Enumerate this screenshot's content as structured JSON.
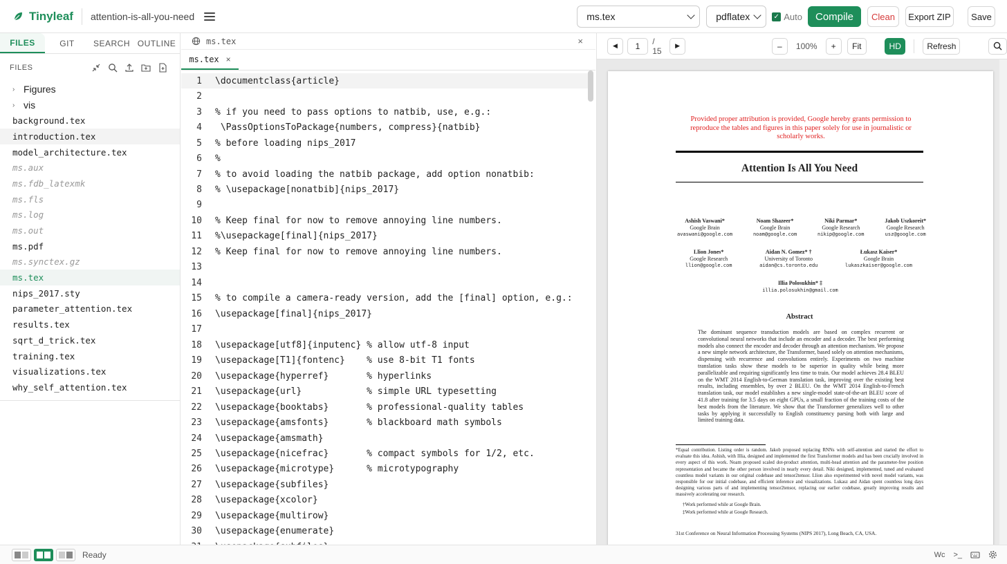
{
  "app": {
    "name": "Tinyleaf",
    "project": "attention-is-all-you-need"
  },
  "toolbar": {
    "main_file": "ms.tex",
    "engine": "pdflatex",
    "auto_label": "Auto",
    "compile_label": "Compile",
    "clean_label": "Clean",
    "export_label": "Export ZIP",
    "save_label": "Save"
  },
  "sidebar": {
    "tabs": [
      "FILES",
      "GIT",
      "SEARCH",
      "OUTLINE"
    ],
    "files_heading": "FILES",
    "items": [
      {
        "name": "Figures",
        "type": "folder"
      },
      {
        "name": "vis",
        "type": "folder"
      },
      {
        "name": "background.tex",
        "type": "file"
      },
      {
        "name": "introduction.tex",
        "type": "file"
      },
      {
        "name": "model_architecture.tex",
        "type": "file"
      },
      {
        "name": "ms.aux",
        "type": "generated"
      },
      {
        "name": "ms.fdb_latexmk",
        "type": "generated"
      },
      {
        "name": "ms.fls",
        "type": "generated"
      },
      {
        "name": "ms.log",
        "type": "generated"
      },
      {
        "name": "ms.out",
        "type": "generated"
      },
      {
        "name": "ms.pdf",
        "type": "file"
      },
      {
        "name": "ms.synctex.gz",
        "type": "generated"
      },
      {
        "name": "ms.tex",
        "type": "active"
      },
      {
        "name": "nips_2017.sty",
        "type": "file"
      },
      {
        "name": "parameter_attention.tex",
        "type": "file"
      },
      {
        "name": "results.tex",
        "type": "file"
      },
      {
        "name": "sqrt_d_trick.tex",
        "type": "file"
      },
      {
        "name": "training.tex",
        "type": "file"
      },
      {
        "name": "visualizations.tex",
        "type": "file"
      },
      {
        "name": "why_self_attention.tex",
        "type": "file"
      }
    ]
  },
  "editor": {
    "path": "ms.tex",
    "tab": "ms.tex",
    "lines": [
      "\\documentclass{article}",
      "",
      "% if you need to pass options to natbib, use, e.g.:",
      " \\PassOptionsToPackage{numbers, compress}{natbib}",
      "% before loading nips_2017",
      "%",
      "% to avoid loading the natbib package, add option nonatbib:",
      "% \\usepackage[nonatbib]{nips_2017}",
      "",
      "% Keep final for now to remove annoying line numbers.",
      "%\\usepackage[final]{nips_2017}",
      "% Keep final for now to remove annoying line numbers.",
      "",
      "",
      "% to compile a camera-ready version, add the [final] option, e.g.:",
      "\\usepackage[final]{nips_2017}",
      "",
      "\\usepackage[utf8]{inputenc} % allow utf-8 input",
      "\\usepackage[T1]{fontenc}    % use 8-bit T1 fonts",
      "\\usepackage{hyperref}       % hyperlinks",
      "\\usepackage{url}            % simple URL typesetting",
      "\\usepackage{booktabs}       % professional-quality tables",
      "\\usepackage{amsfonts}       % blackboard math symbols",
      "\\usepackage{amsmath}",
      "\\usepackage{nicefrac}       % compact symbols for 1/2, etc.",
      "\\usepackage{microtype}      % microtypography",
      "\\usepackage{subfiles}",
      "\\usepackage{xcolor}",
      "\\usepackage{multirow}",
      "\\usepackage{enumerate}",
      "\\usepackage{subfiles}"
    ]
  },
  "viewer": {
    "page": "1",
    "total": "/ 15",
    "zoom": "100%",
    "fit_label": "Fit",
    "hd_label": "HD",
    "refresh_label": "Refresh",
    "pdf": {
      "notice": "Provided proper attribution is provided, Google hereby grants permission to reproduce the tables and figures in this paper solely for use in journalistic or scholarly works.",
      "title": "Attention Is All You Need",
      "authors_row1": [
        {
          "name": "Ashish Vaswani*",
          "aff": "Google Brain",
          "email": "avaswani@google.com"
        },
        {
          "name": "Noam Shazeer*",
          "aff": "Google Brain",
          "email": "noam@google.com"
        },
        {
          "name": "Niki Parmar*",
          "aff": "Google Research",
          "email": "nikip@google.com"
        },
        {
          "name": "Jakob Uszkoreit*",
          "aff": "Google Research",
          "email": "usz@google.com"
        }
      ],
      "authors_row2": [
        {
          "name": "Llion Jones*",
          "aff": "Google Research",
          "email": "llion@google.com"
        },
        {
          "name": "Aidan N. Gomez* †",
          "aff": "University of Toronto",
          "email": "aidan@cs.toronto.edu"
        },
        {
          "name": "Łukasz Kaiser*",
          "aff": "Google Brain",
          "email": "lukaszkaiser@google.com"
        }
      ],
      "authors_row3": [
        {
          "name": "Illia Polosukhin* ‡",
          "aff": "",
          "email": "illia.polosukhin@gmail.com"
        }
      ],
      "abstract_heading": "Abstract",
      "abstract": "The dominant sequence transduction models are based on complex recurrent or convolutional neural networks that include an encoder and a decoder. The best performing models also connect the encoder and decoder through an attention mechanism. We propose a new simple network architecture, the Transformer, based solely on attention mechanisms, dispensing with recurrence and convolutions entirely. Experiments on two machine translation tasks show these models to be superior in quality while being more parallelizable and requiring significantly less time to train. Our model achieves 28.4 BLEU on the WMT 2014 English-to-German translation task, improving over the existing best results, including ensembles, by over 2 BLEU. On the WMT 2014 English-to-French translation task, our model establishes a new single-model state-of-the-art BLEU score of 41.8 after training for 3.5 days on eight GPUs, a small fraction of the training costs of the best models from the literature. We show that the Transformer generalizes well to other tasks by applying it successfully to English constituency parsing both with large and limited training data.",
      "footnote1": "*Equal contribution. Listing order is random. Jakob proposed replacing RNNs with self-attention and started the effort to evaluate this idea. Ashish, with Illia, designed and implemented the first Transformer models and has been crucially involved in every aspect of this work. Noam proposed scaled dot-product attention, multi-head attention and the parameter-free position representation and became the other person involved in nearly every detail. Niki designed, implemented, tuned and evaluated countless model variants in our original codebase and tensor2tensor. Llion also experimented with novel model variants, was responsible for our initial codebase, and efficient inference and visualizations. Lukasz and Aidan spent countless long days designing various parts of and implementing tensor2tensor, replacing our earlier codebase, greatly improving results and massively accelerating our research.",
      "footnote2": "†Work performed while at Google Brain.",
      "footnote3": "‡Work performed while at Google Research.",
      "conference": "31st Conference on Neural Information Processing Systems (NIPS 2017), Long Beach, CA, USA."
    }
  },
  "status": {
    "text": "Ready",
    "wc": "Wc",
    "terminal": ">_"
  },
  "colors": {
    "accent": "#1e8e5a",
    "danger": "#d63a3a",
    "notice": "#e02020"
  }
}
